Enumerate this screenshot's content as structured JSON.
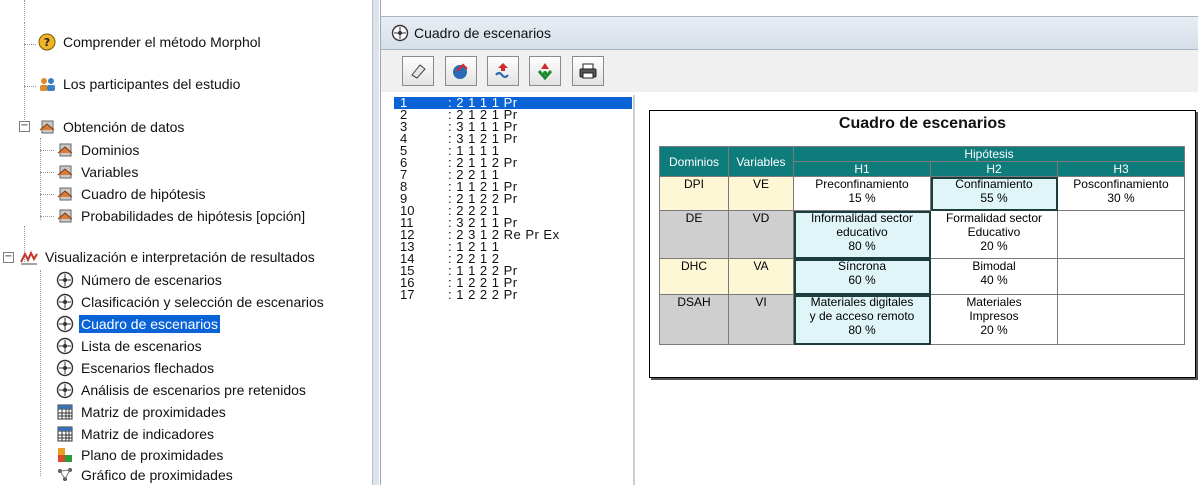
{
  "tree": {
    "items": [
      {
        "label": "Comprender el método Morphol",
        "icon": "help-icon"
      },
      {
        "label": "Los participantes del estudio",
        "icon": "people-icon"
      },
      {
        "label": "Obtención de datos",
        "icon": "data-icon"
      },
      {
        "label": "Dominios",
        "icon": "data-icon"
      },
      {
        "label": "Variables",
        "icon": "data-icon"
      },
      {
        "label": "Cuadro de hipótesis",
        "icon": "data-icon"
      },
      {
        "label": "Probabilidades de hipótesis [opción]",
        "icon": "data-icon"
      },
      {
        "label": "Visualización e interpretación de resultados",
        "icon": "chart-icon"
      },
      {
        "label": "Número de escenarios",
        "icon": "scenario-icon"
      },
      {
        "label": "Clasificación y selección de escenarios",
        "icon": "scenario-icon"
      },
      {
        "label": "Cuadro de escenarios",
        "icon": "scenario-icon"
      },
      {
        "label": "Lista de escenarios",
        "icon": "scenario-icon"
      },
      {
        "label": "Escenarios flechados",
        "icon": "scenario-icon"
      },
      {
        "label": "Análisis de escenarios pre retenidos",
        "icon": "scenario-icon"
      },
      {
        "label": "Matriz de proximidades",
        "icon": "matrix-icon"
      },
      {
        "label": "Matriz de indicadores",
        "icon": "matrix-icon"
      },
      {
        "label": "Plano de proximidades",
        "icon": "plane-icon"
      },
      {
        "label": "Gráfico de proximidades",
        "icon": "graph-icon"
      }
    ]
  },
  "panel": {
    "title": "Cuadro de escenarios",
    "toolbar_icons": [
      "eraser-icon",
      "export-icon",
      "import-icon",
      "recycle-icon",
      "print-icon"
    ]
  },
  "scenarios": [
    {
      "n": "1",
      "code": ": 2 1 1 1 Pr"
    },
    {
      "n": "2",
      "code": ": 2 1 2 1 Pr"
    },
    {
      "n": "3",
      "code": ": 3 1 1 1 Pr"
    },
    {
      "n": "4",
      "code": ": 3 1 2 1 Pr"
    },
    {
      "n": "5",
      "code": ": 1 1 1 1"
    },
    {
      "n": "6",
      "code": ": 2 1 1 2 Pr"
    },
    {
      "n": "7",
      "code": ": 2 2 1 1"
    },
    {
      "n": "8",
      "code": ": 1 1 2 1 Pr"
    },
    {
      "n": "9",
      "code": ": 2 1 2 2 Pr"
    },
    {
      "n": "10",
      "code": ": 2 2 2 1"
    },
    {
      "n": "11",
      "code": ": 3 2 1 1 Pr"
    },
    {
      "n": "12",
      "code": ": 2 3 1 2 Re Pr Ex"
    },
    {
      "n": "13",
      "code": ": 1 2 1 1"
    },
    {
      "n": "14",
      "code": ": 2 2 1 2"
    },
    {
      "n": "15",
      "code": ": 1 1 2 2 Pr"
    },
    {
      "n": "16",
      "code": ": 1 2 2 1 Pr"
    },
    {
      "n": "17",
      "code": ": 1 2 2 2 Pr"
    }
  ],
  "table": {
    "title": "Cuadro de escenarios",
    "headers": {
      "dominios": "Dominios",
      "variables": "Variables",
      "hipotesis": "Hipótesis",
      "h": [
        "H1",
        "H2",
        "H3"
      ]
    },
    "rows": [
      {
        "dom": "DPI",
        "var": "VE",
        "cells": [
          [
            "Preconfinamiento",
            "15 %"
          ],
          [
            "Confinamiento",
            "55 %"
          ],
          [
            "Posconfinamiento",
            "30 %"
          ]
        ]
      },
      {
        "dom": "DE",
        "var": "VD",
        "cells": [
          [
            "Informalidad sector",
            "educativo",
            "80 %"
          ],
          [
            "Formalidad sector",
            "Educativo",
            "20 %"
          ],
          []
        ]
      },
      {
        "dom": "DHC",
        "var": "VA",
        "cells": [
          [
            "Síncrona",
            "60 %"
          ],
          [
            "Bimodal",
            "40 %"
          ],
          []
        ]
      },
      {
        "dom": "DSAH",
        "var": "VI",
        "cells": [
          [
            "Materiales digitales",
            "y de acceso remoto",
            "80 %"
          ],
          [
            "Materiales",
            "Impresos",
            "20 %"
          ],
          []
        ]
      }
    ]
  },
  "colors": {
    "accent": "#0f7c7c",
    "selection": "#0a64d8"
  }
}
